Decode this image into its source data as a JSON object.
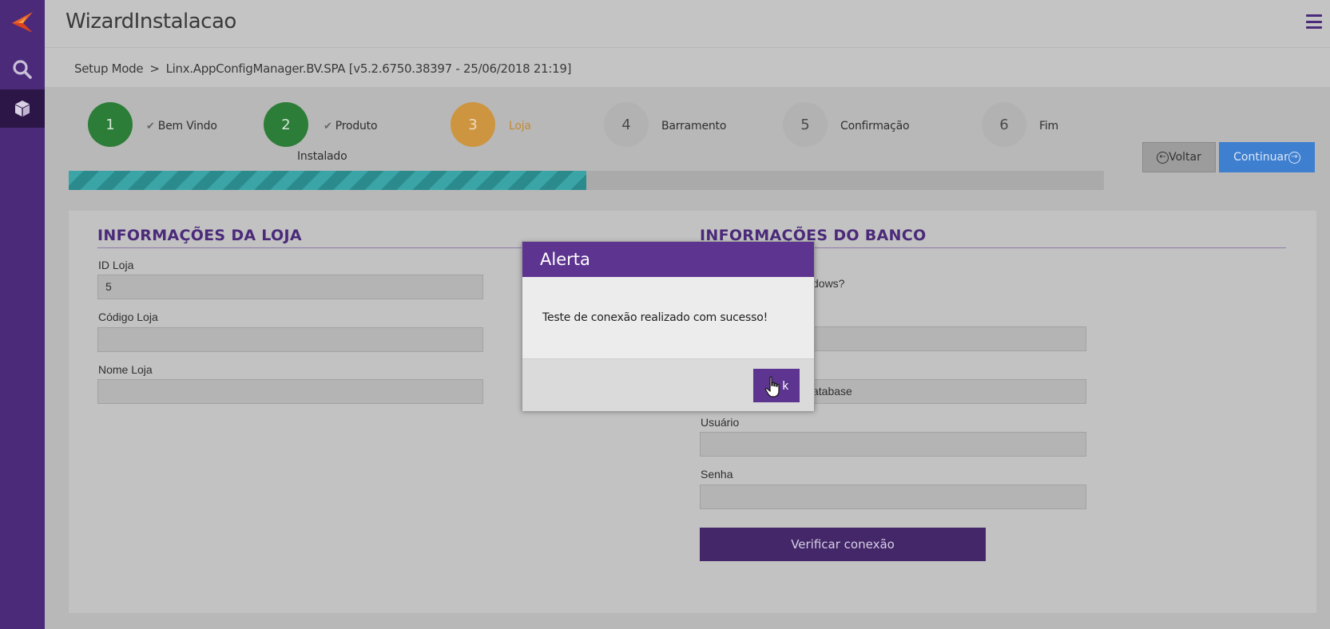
{
  "app": {
    "title": "WizardInstalacao",
    "menu_icon": "hamburger-menu-icon",
    "brand_color": "#4a2a79"
  },
  "sidebar": {
    "items": [
      {
        "icon": "linx-logo-icon"
      },
      {
        "icon": "search-icon"
      },
      {
        "icon": "cube-icon"
      }
    ]
  },
  "breadcrumb": {
    "root": "Setup Mode",
    "separator": ">",
    "current": "Linx.AppConfigManager.BV.SPA [v5.2.6750.38397 - 25/06/2018 21:19]"
  },
  "wizard": {
    "steps": [
      {
        "number": "1",
        "label": "Bem Vindo",
        "state": "done",
        "label_line2": ""
      },
      {
        "number": "2",
        "label": "Produto",
        "state": "done",
        "label_line2": "Instalado"
      },
      {
        "number": "3",
        "label": "Loja",
        "state": "active",
        "label_line2": ""
      },
      {
        "number": "4",
        "label": "Barramento",
        "state": "todo",
        "label_line2": ""
      },
      {
        "number": "5",
        "label": "Confirmação",
        "state": "todo",
        "label_line2": ""
      },
      {
        "number": "6",
        "label": "Fim",
        "state": "todo",
        "label_line2": ""
      }
    ],
    "progress": 0.5,
    "voltar_label": "Voltar",
    "continuar_label": "Continuar"
  },
  "loja": {
    "title": "INFORMAÇÕES DA LOJA",
    "id_label": "ID Loja",
    "id_value": "5",
    "codigo_label": "Código Loja",
    "codigo_value": "",
    "nome_label": "Nome Loja",
    "nome_value": ""
  },
  "banco": {
    "title": "INFORMAÇÕES DO BANCO",
    "windows_question_partial": "dows?",
    "database_partial": "atabase",
    "usuario_label": "Usuário",
    "usuario_value": "",
    "senha_label": "Senha",
    "senha_value": "",
    "verificar_label": "Verificar conexão"
  },
  "alert": {
    "title": "Alerta",
    "message": "Teste de conexão realizado com sucesso!",
    "ok_label": "k"
  }
}
